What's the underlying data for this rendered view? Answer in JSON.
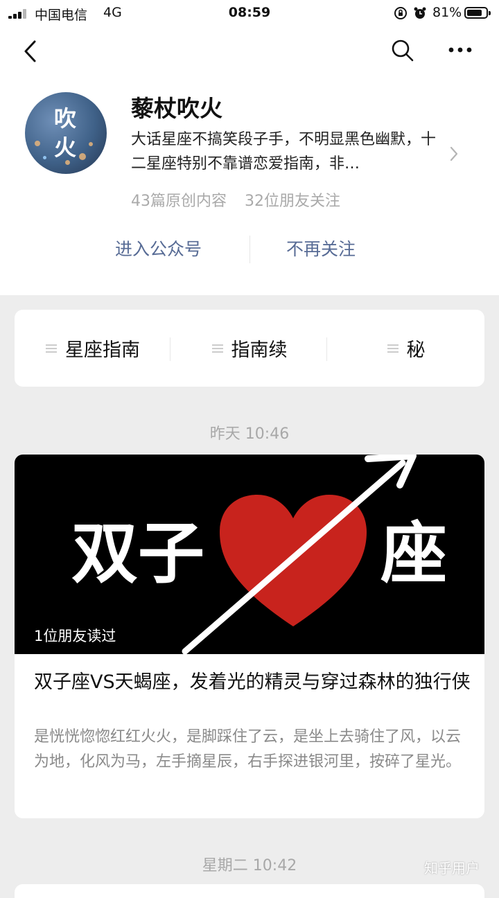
{
  "status_bar": {
    "carrier": "中国电信",
    "network": "4G",
    "time": "08:59",
    "battery_percent": "81%",
    "battery_level": 0.81,
    "icons": [
      "signal-icon",
      "rotation-lock-icon",
      "alarm-icon",
      "battery-icon"
    ]
  },
  "nav": {
    "back_icon": "chevron-left-icon",
    "search_icon": "search-icon",
    "more_icon": "more-horizontal-icon"
  },
  "account": {
    "avatar_text": "吹火",
    "name": "藜杖吹火",
    "description": "大话星座不搞笑段子手，不明显黑色幽默，十二星座特别不靠谱恋爱指南，非…",
    "articles_count": "43篇原创内容",
    "friends_follow": "32位朋友关注",
    "enter_label": "进入公众号",
    "unfollow_label": "不再关注"
  },
  "menu": {
    "items": [
      {
        "label": "星座指南",
        "icon": "list-icon"
      },
      {
        "label": "指南续",
        "icon": "list-icon"
      },
      {
        "label": "秘",
        "icon": "list-icon"
      }
    ]
  },
  "feed": {
    "groups": [
      {
        "date": "昨天 10:46",
        "article": {
          "cover": {
            "text_left": "双子",
            "text_right": "座",
            "read_by": "1位朋友读过",
            "colors": {
              "heart": "#c8231d",
              "arrow": "#ffffff",
              "background": "#000000"
            }
          },
          "title": "双子座VS天蝎座，发着光的精灵与穿过森林的独行侠",
          "digest": "是恍恍惚惚红红火火，是脚踩住了云，是坐上去骑住了风，以云为地，化风为马，左手摘星辰，右手探进银河里，按碎了星光。"
        }
      },
      {
        "date": "星期二 10:42"
      }
    ]
  },
  "watermark": "知乎用户",
  "colors": {
    "link_blue": "#576b95",
    "page_bg": "#ededed",
    "muted_text": "#aaaaaa"
  }
}
